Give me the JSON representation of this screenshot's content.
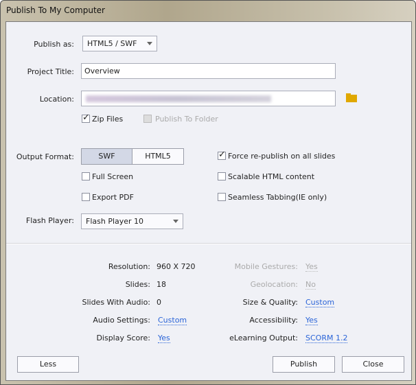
{
  "window": {
    "title": "Publish To My Computer"
  },
  "form": {
    "publish_as_label": "Publish as:",
    "publish_as_value": "HTML5 / SWF",
    "project_title_label": "Project Title:",
    "project_title_value": "Overview",
    "location_label": "Location:",
    "zip_files_label": "Zip Files",
    "zip_files_checked": true,
    "publish_to_folder_label": "Publish To Folder",
    "publish_to_folder_checked": false,
    "output_format_label": "Output Format:",
    "output_formats": [
      "SWF",
      "HTML5"
    ],
    "output_format_selected": "SWF",
    "full_screen_label": "Full Screen",
    "export_pdf_label": "Export PDF",
    "force_republish_label": "Force re-publish on all slides",
    "force_republish_checked": true,
    "scalable_label": "Scalable HTML content",
    "seamless_label": "Seamless Tabbing(IE only)",
    "flash_player_label": "Flash Player:",
    "flash_player_value": "Flash Player 10"
  },
  "info": {
    "left": [
      {
        "label": "Resolution:",
        "value": "960 X 720"
      },
      {
        "label": "Slides:",
        "value": "18"
      },
      {
        "label": "Slides With Audio:",
        "value": "0"
      },
      {
        "label": "Audio Settings:",
        "value": "Custom"
      },
      {
        "label": "Display Score:",
        "value": "Yes"
      }
    ],
    "right": [
      {
        "label": "Mobile Gestures:",
        "value": "Yes"
      },
      {
        "label": "Geolocation:",
        "value": "No"
      },
      {
        "label": "Size & Quality:",
        "value": "Custom"
      },
      {
        "label": "Accessibility:",
        "value": "Yes"
      },
      {
        "label": "eLearning Output:",
        "value": "SCORM 1.2"
      }
    ]
  },
  "buttons": {
    "less": "Less",
    "publish": "Publish",
    "close": "Close"
  },
  "colors": {
    "link": "#2a64d8",
    "folder": "#e0a800",
    "panel": "#f0f1f6"
  }
}
